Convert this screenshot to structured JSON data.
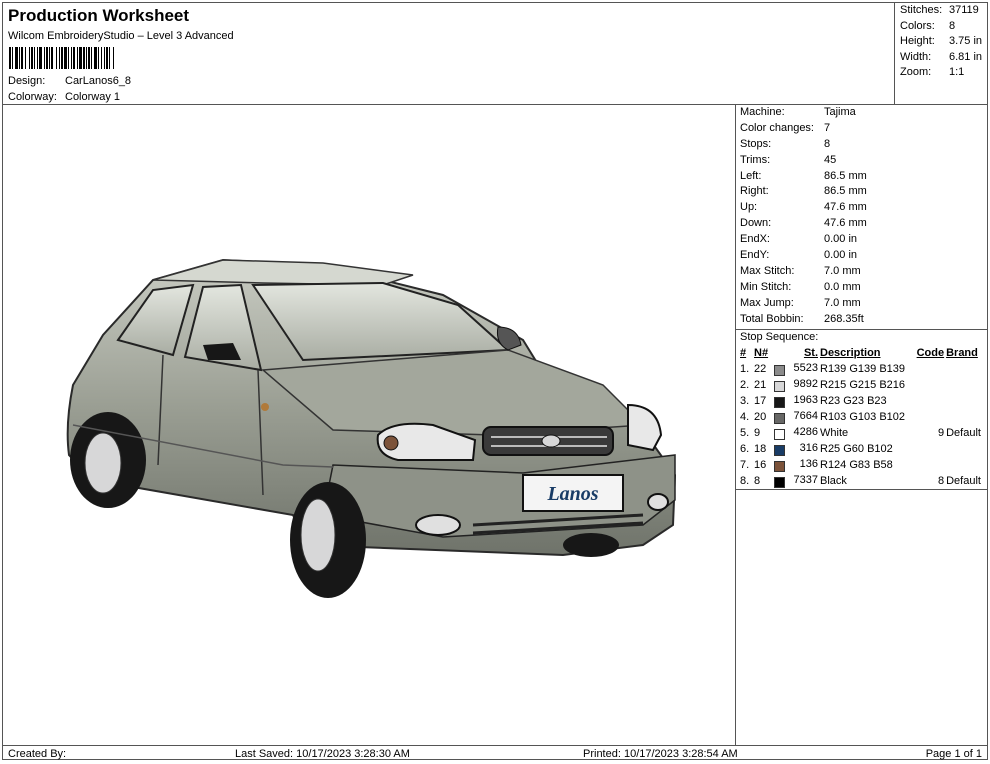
{
  "header": {
    "title": "Production Worksheet",
    "subtitle": "Wilcom EmbroideryStudio – Level 3 Advanced",
    "design_label": "Design:",
    "design_value": "CarLanos6_8",
    "colorway_label": "Colorway:",
    "colorway_value": "Colorway 1"
  },
  "summary": [
    {
      "label": "Stitches:",
      "value": "37119"
    },
    {
      "label": "Colors:",
      "value": "8"
    },
    {
      "label": "Height:",
      "value": "3.75 in"
    },
    {
      "label": "Width:",
      "value": "6.81 in"
    },
    {
      "label": "Zoom:",
      "value": "1:1"
    }
  ],
  "machine_info": [
    {
      "label": "Machine:",
      "value": "Tajima"
    },
    {
      "label": "Color changes:",
      "value": "7"
    },
    {
      "label": "Stops:",
      "value": "8"
    },
    {
      "label": "Trims:",
      "value": "45"
    },
    {
      "label": "Left:",
      "value": "86.5 mm"
    },
    {
      "label": "Right:",
      "value": "86.5 mm"
    },
    {
      "label": "Up:",
      "value": "47.6 mm"
    },
    {
      "label": "Down:",
      "value": "47.6 mm"
    },
    {
      "label": "EndX:",
      "value": "0.00 in"
    },
    {
      "label": "EndY:",
      "value": "0.00 in"
    },
    {
      "label": "Max Stitch:",
      "value": "7.0 mm"
    },
    {
      "label": "Min Stitch:",
      "value": "0.0 mm"
    },
    {
      "label": "Max Jump:",
      "value": "7.0 mm"
    },
    {
      "label": "Total Bobbin:",
      "value": "268.35ft"
    }
  ],
  "stop_sequence": {
    "title": "Stop Sequence:",
    "headers": {
      "num": "#",
      "n": "N#",
      "st": "St.",
      "desc": "Description",
      "code": "Code",
      "brand": "Brand"
    },
    "rows": [
      {
        "num": "1.",
        "n": "22",
        "color": "#8b8b8b",
        "st": "5523",
        "desc": "R139 G139 B139",
        "code": "",
        "brand": ""
      },
      {
        "num": "2.",
        "n": "21",
        "color": "#d7d7d8",
        "st": "9892",
        "desc": "R215 G215 B216",
        "code": "",
        "brand": ""
      },
      {
        "num": "3.",
        "n": "17",
        "color": "#171717",
        "st": "1963",
        "desc": "R23 G23 B23",
        "code": "",
        "brand": ""
      },
      {
        "num": "4.",
        "n": "20",
        "color": "#676766",
        "st": "7664",
        "desc": "R103 G103 B102",
        "code": "",
        "brand": ""
      },
      {
        "num": "5.",
        "n": "9",
        "color": "#ffffff",
        "st": "4286",
        "desc": "White",
        "code": "9",
        "brand": "Default"
      },
      {
        "num": "6.",
        "n": "18",
        "color": "#193c66",
        "st": "316",
        "desc": "R25 G60 B102",
        "code": "",
        "brand": ""
      },
      {
        "num": "7.",
        "n": "16",
        "color": "#7c533a",
        "st": "136",
        "desc": "R124 G83 B58",
        "code": "",
        "brand": ""
      },
      {
        "num": "8.",
        "n": "8",
        "color": "#000000",
        "st": "7337",
        "desc": "Black",
        "code": "8",
        "brand": "Default"
      }
    ]
  },
  "design_preview": {
    "plate_text": "Lanos",
    "body_color": "#8b8b8b",
    "dark_color": "#171717",
    "light_color": "#d7d7d8"
  },
  "footer": {
    "created_by": "Created By:",
    "last_saved": "Last Saved: 10/17/2023 3:28:30 AM",
    "printed": "Printed: 10/17/2023 3:28:54 AM",
    "page": "Page 1 of 1"
  }
}
